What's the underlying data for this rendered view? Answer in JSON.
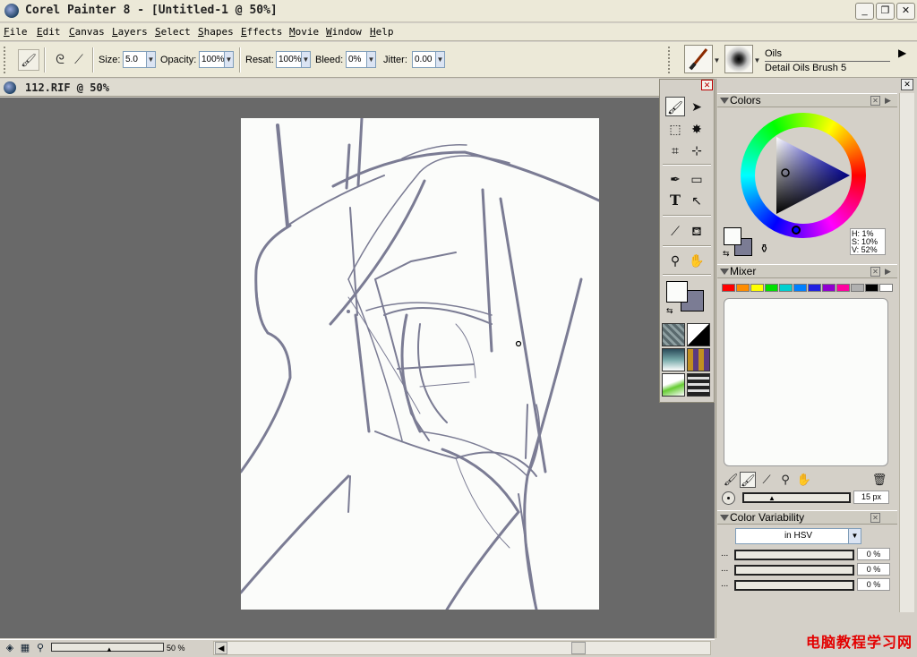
{
  "app": {
    "title": "Corel Painter 8 - [Untitled-1 @ 50%]",
    "window_buttons": {
      "minimize": "_",
      "maximize": "❐",
      "close": "✕"
    }
  },
  "menu": [
    "File",
    "Edit",
    "Canvas",
    "Layers",
    "Select",
    "Shapes",
    "Effects",
    "Movie",
    "Window",
    "Help"
  ],
  "property_bar": {
    "size_label": "Size:",
    "size_value": "5.0",
    "opacity_label": "Opacity:",
    "opacity_value": "100%",
    "resat_label": "Resat:",
    "resat_value": "100%",
    "bleed_label": "Bleed:",
    "bleed_value": "0%",
    "jitter_label": "Jitter:",
    "jitter_value": "0.00",
    "brush_category": "Oils",
    "brush_variant": "Detail Oils Brush 5"
  },
  "document": {
    "title": "112.RIF @ 50%",
    "zoom_value": "50 %",
    "canvas_color": "#fbfcfa",
    "stroke_color": "#7b7c94",
    "area_color": "#696969"
  },
  "toolbox": {
    "tools": [
      "brush-icon",
      "layer-adjuster-icon",
      "rect-select-icon",
      "magic-wand-icon",
      "crop-icon",
      "transform-icon",
      "pen-icon",
      "rectangle-shape-icon",
      "text-icon",
      "shape-select-icon",
      "dropper-icon",
      "paint-bucket-icon",
      "magnifier-icon",
      "grabber-icon"
    ],
    "main_color": "#fbfcfa",
    "additional_color": "#7b7c94"
  },
  "colors_panel": {
    "title": "Colors",
    "h": "H: 1%",
    "s": "S: 10%",
    "v": "V: 52%"
  },
  "mixer_panel": {
    "title": "Mixer",
    "swatches": [
      "#ff0000",
      "#ff8c00",
      "#ffff00",
      "#00e000",
      "#00d0d0",
      "#0080ff",
      "#2020e0",
      "#9000d0",
      "#ff00a0",
      "#b0b0b0",
      "#000000",
      "#ffffff"
    ],
    "brush_size": "15 px"
  },
  "variability_panel": {
    "title": "Color Variability",
    "mode": "in HSV",
    "rows": [
      {
        "dots": "...",
        "value": "0 %"
      },
      {
        "dots": "...",
        "value": "0 %"
      },
      {
        "dots": "...",
        "value": "0 %"
      }
    ]
  },
  "watermark": "电脑教程学习网"
}
